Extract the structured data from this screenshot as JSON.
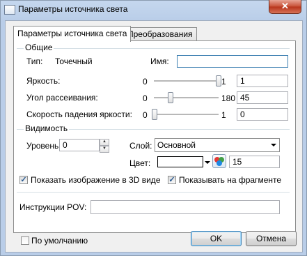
{
  "window": {
    "title": "Параметры источника света",
    "close_glyph": "✕"
  },
  "tabs": [
    {
      "label": "Параметры источника света",
      "active": true
    },
    {
      "label": "Преобразования",
      "active": false
    }
  ],
  "general": {
    "group_title": "Общие",
    "type_label": "Тип:",
    "type_value": "Точечный",
    "name_label": "Имя:",
    "name_value": "",
    "brightness": {
      "label": "Яркость:",
      "min": "0",
      "max": "1",
      "value": "1",
      "slider_fraction": 1.0
    },
    "scatter_angle": {
      "label": "Угол рассеивания:",
      "min": "0",
      "max": "180",
      "value": "45",
      "slider_fraction": 0.25
    },
    "falloff_speed": {
      "label": "Скорость падения яркости:",
      "min": "0",
      "max": "1",
      "value": "0",
      "slider_fraction": 0.0
    }
  },
  "visibility": {
    "group_title": "Видимость",
    "level_label": "Уровень:",
    "level_value": "0",
    "layer_label": "Слой:",
    "layer_value": "Основной",
    "color_label": "Цвет:",
    "color_hex": "#ffffff",
    "color_number": "15",
    "show_3d_label": "Показать изображение в 3D виде",
    "show_3d_checked": true,
    "show_fragment_label": "Показывать  на фрагменте",
    "show_fragment_checked": true
  },
  "pov": {
    "label": "Инструкции POV:",
    "value": ""
  },
  "footer": {
    "default_label": "По умолчанию",
    "default_checked": false,
    "ok_label": "OK",
    "cancel_label": "Отмена"
  },
  "icons": [
    "app-icon",
    "close-icon",
    "spin-up-icon",
    "spin-down-icon",
    "dropdown-arrow-icon",
    "color-palette-icon",
    "checkmark-icon"
  ]
}
